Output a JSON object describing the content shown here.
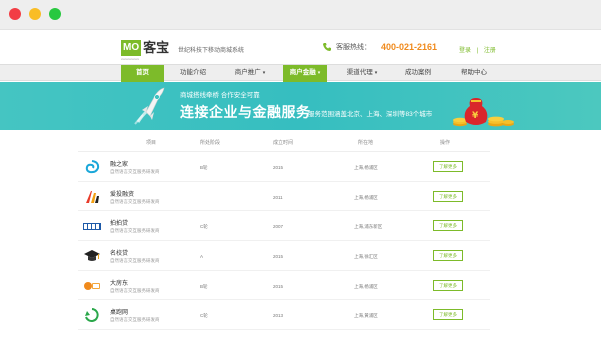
{
  "header": {
    "logo_mark": "MO",
    "logo_name": "客宝",
    "logo_sub": "xxxxxxxxxxxx",
    "slogan": "世纪科技下移动商城系统",
    "hotline_label": "客服热线：",
    "hotline_number": "400-021-2161",
    "login": "登录",
    "register": "注册",
    "auth_sep": "|"
  },
  "nav": {
    "items": [
      {
        "label": "首页",
        "active": true
      },
      {
        "label": "功能介绍",
        "active": false
      },
      {
        "label": "商户推广",
        "active": false,
        "arrow": "▾"
      },
      {
        "label": "商户金融",
        "active": true,
        "arrow": "▾"
      },
      {
        "label": "渠道代理",
        "active": false,
        "arrow": "▾"
      },
      {
        "label": "成功案例",
        "active": false
      },
      {
        "label": "帮助中心",
        "active": false
      }
    ]
  },
  "banner": {
    "tag": "商城搭线牵桥  合作安全可靠",
    "title": "连接企业与金融服务",
    "subtitle": "服务范围涵盖北京、上海、深圳等83个城市"
  },
  "table": {
    "headers": [
      "项目",
      "所处阶段",
      "成立时间",
      "所在地",
      "操作"
    ],
    "rows": [
      {
        "name": "融之家",
        "desc": "自然语言交互服务研发商",
        "stage": "B轮",
        "year": "2015",
        "city": "上海,杨浦区",
        "action": "了解更多"
      },
      {
        "name": "爱投融资",
        "desc": "自然语言交互服务研发商",
        "stage": "",
        "year": "2011",
        "city": "上海,杨浦区",
        "action": "了解更多"
      },
      {
        "name": "拍拍贷",
        "desc": "自然语言交互服务研发商",
        "stage": "C轮",
        "year": "2007",
        "city": "上海,浦东新区",
        "action": "了解更多"
      },
      {
        "name": "名校贷",
        "desc": "自然语言交互服务研发商",
        "stage": "A",
        "year": "2015",
        "city": "上海,徐汇区",
        "action": "了解更多"
      },
      {
        "name": "大房东",
        "desc": "自然语言交互服务研发商",
        "stage": "B轮",
        "year": "2015",
        "city": "上海,杨浦区",
        "action": "了解更多"
      },
      {
        "name": "桌跑网",
        "desc": "自然语言交互服务研发商",
        "stage": "C轮",
        "year": "2013",
        "city": "上海,黄浦区",
        "action": "了解更多"
      }
    ]
  },
  "colors": {
    "brand_green": "#7dbb2a",
    "banner_teal": "#3fc2c1",
    "hotline_orange": "#f08a1c"
  }
}
